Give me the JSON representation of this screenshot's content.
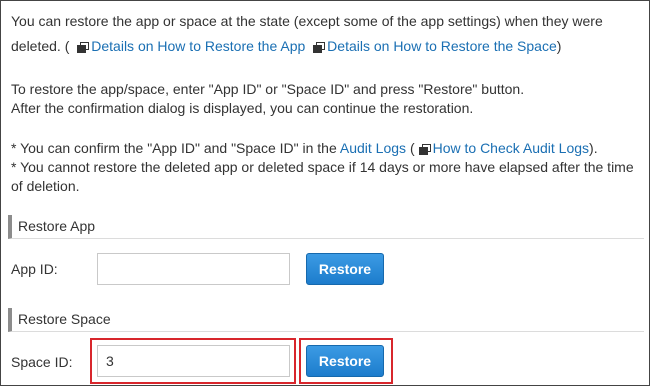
{
  "intro": {
    "line1": "You can restore the app or space at the state (except some of the app settings) when they were",
    "line2_prefix": "deleted. (",
    "link_restore_app": "Details on How to Restore the App",
    "link_restore_space": "Details on How to Restore the Space",
    "line2_suffix": ")"
  },
  "instructions": {
    "line1": "To restore the app/space, enter \"App ID\" or \"Space ID\" and press \"Restore\" button.",
    "line2": "After the confirmation dialog is displayed, you can continue the restoration."
  },
  "notes": {
    "note1_prefix": "* You can confirm the \"App ID\" and \"Space ID\" in the",
    "audit_logs_link": "Audit Logs",
    "note1_mid": "(",
    "check_audit_logs_link": "How to Check Audit Logs",
    "note1_suffix": ").",
    "note2_line1": "* You cannot restore the deleted app or deleted space if 14 days or more have elapsed after the time",
    "note2_line2": "of deletion."
  },
  "restore_app": {
    "header": "Restore App",
    "label": "App ID:",
    "value": "",
    "button": "Restore"
  },
  "restore_space": {
    "header": "Restore Space",
    "label": "Space ID:",
    "value": "3",
    "button": "Restore"
  },
  "colors": {
    "link": "#1a6fb3",
    "button": "#1c7ccc",
    "highlight": "#d8262c"
  },
  "icons": {
    "external_link": "new-window-icon"
  }
}
